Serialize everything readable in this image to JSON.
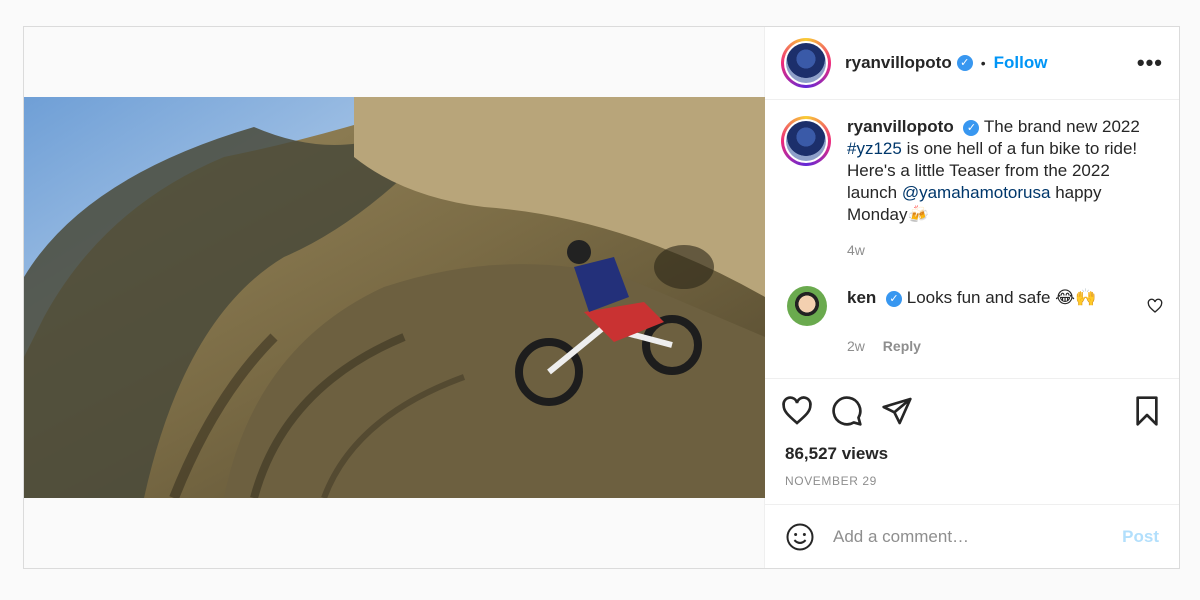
{
  "header": {
    "username": "ryanvillopoto",
    "separator": "•",
    "follow_label": "Follow",
    "more_label": "•••"
  },
  "caption": {
    "username": "ryanvillopoto",
    "text_before_hashtag": "The brand new 2022",
    "hashtag": "#yz125",
    "text_middle": "is one hell of a fun bike to ride! Here's a little Teaser from the 2022 launch",
    "mention": "@yamahamotorusa",
    "text_after": "happy Monday🍻",
    "time": "4w"
  },
  "comment": {
    "username": "ken",
    "text": "Looks fun and safe 😂🙌",
    "time": "2w",
    "reply_label": "Reply"
  },
  "stats": {
    "views": "86,527 views",
    "date": "NOVEMBER 29"
  },
  "composer": {
    "placeholder": "Add a comment…",
    "post_label": "Post"
  },
  "colors": {
    "link": "#0095f6",
    "verified": "#3897f0",
    "muted": "#8e8e8e"
  }
}
